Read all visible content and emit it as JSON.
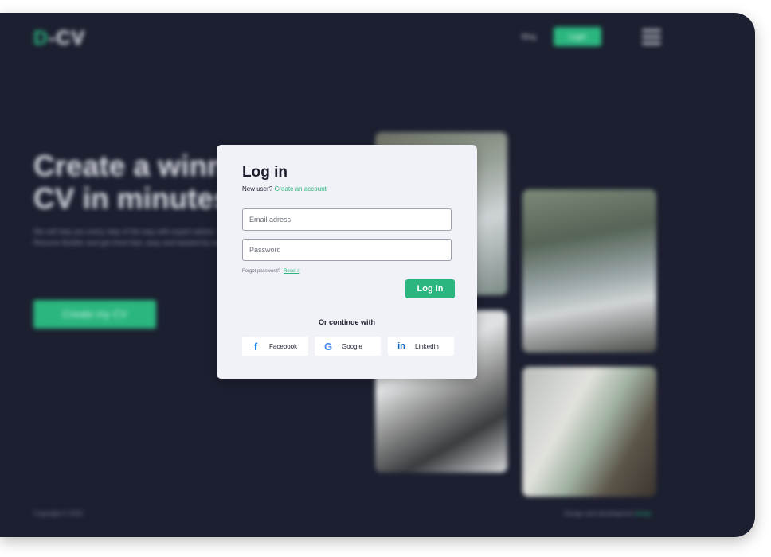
{
  "background": {
    "logo": {
      "d": "D",
      "rest": "-CV"
    },
    "nav": {
      "link": "Blog",
      "button": "Login"
    },
    "hero": {
      "title_line1": "Create a winning",
      "title_line2": "CV in minutes",
      "description": "We will help you every step of the way with expert advice. Try our Resume Builder and get hired fast, easy and backed by experts!",
      "cta": "Create my CV"
    },
    "footer": {
      "copyright": "Copyright © 2022",
      "credit": "Design and development",
      "credit_link": "Anna"
    }
  },
  "modal": {
    "title": "Log in",
    "new_user_prompt": "New user?",
    "create_account": "Create an account",
    "email_placeholder": "Email adress",
    "password_placeholder": "Password",
    "forgot_prompt": "Forgot password?",
    "reset_link": "Reset it",
    "login_button": "Log in",
    "continue_with": "Or continue with",
    "social": [
      {
        "label": "Facebook",
        "icon": "facebook-icon"
      },
      {
        "label": "Google",
        "icon": "google-icon"
      },
      {
        "label": "Linkedin",
        "icon": "linkedin-icon"
      }
    ]
  },
  "colors": {
    "accent": "#2bb67f",
    "background": "#1c1f30",
    "modal": "#f1f2f7"
  }
}
